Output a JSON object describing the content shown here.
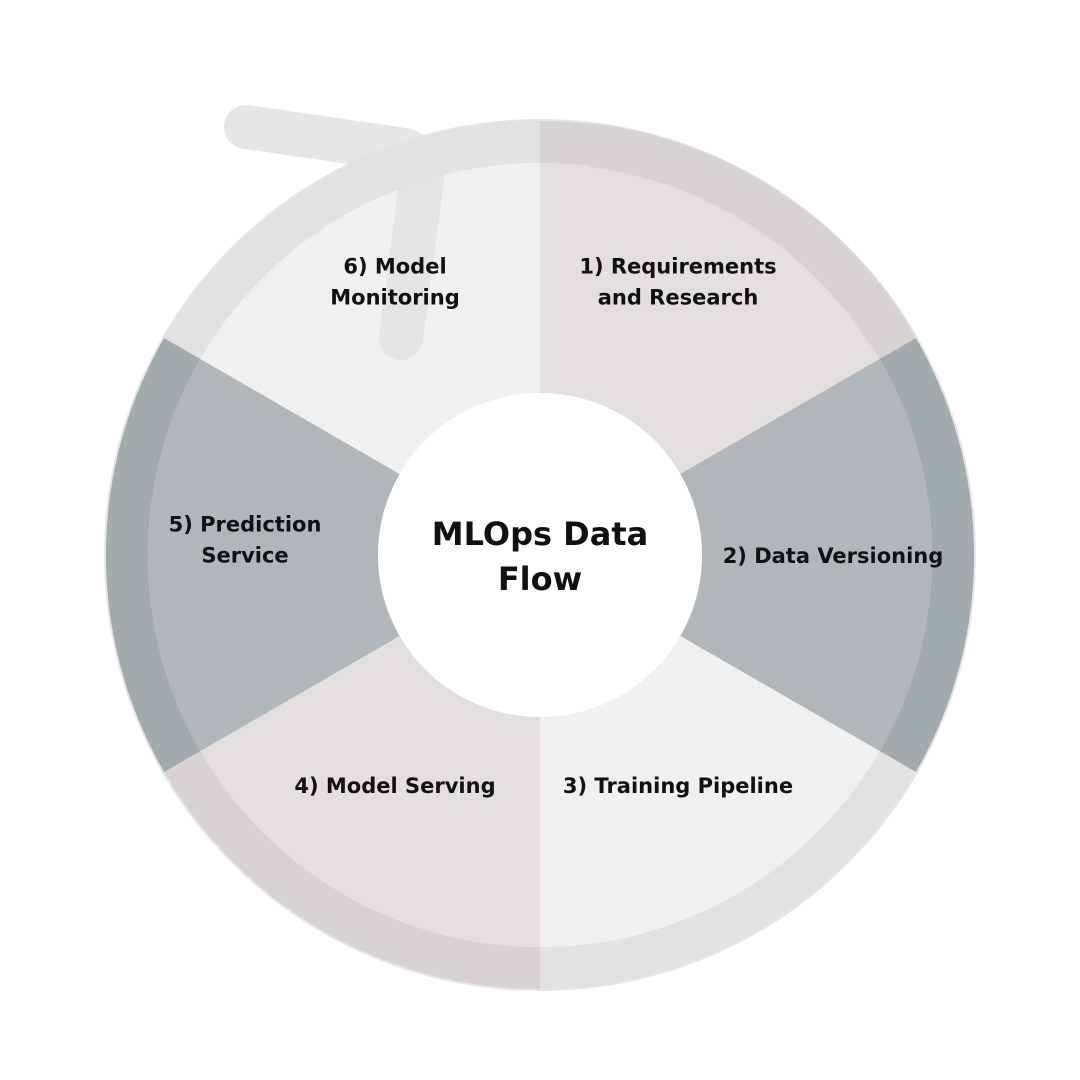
{
  "title_lines": [
    "MLOps Data",
    "Flow"
  ],
  "segments": [
    {
      "lines": [
        "1) Requirements",
        "and Research"
      ],
      "fill": "#e4dfdf",
      "band": "#d8d2d2"
    },
    {
      "lines": [
        "2) Data Versioning"
      ],
      "fill": "#b0b6b9",
      "band": "#a3aaad"
    },
    {
      "lines": [
        "3) Training Pipeline"
      ],
      "fill": "#f0f0f0",
      "band": "#e2e2e2"
    },
    {
      "lines": [
        "4) Model Serving"
      ],
      "fill": "#e4dfdf",
      "band": "#d8d2d2"
    },
    {
      "lines": [
        "5) Prediction",
        "Service"
      ],
      "fill": "#b0b6b9",
      "band": "#a3aaad"
    },
    {
      "lines": [
        "6) Model",
        "Monitoring"
      ],
      "fill": "#f0f0f0",
      "band": "#e2e2e2"
    }
  ],
  "center_fill": "#ffffff",
  "text_color": "#111111",
  "arrow_color": "#e2e2e2"
}
